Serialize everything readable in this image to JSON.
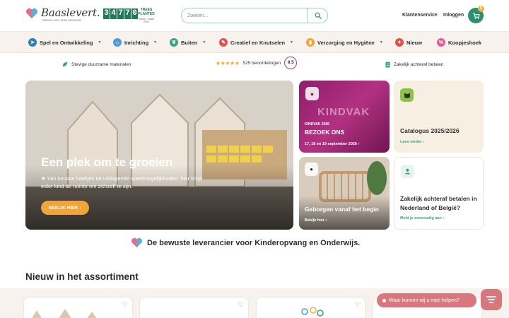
{
  "header": {
    "logo_text": "Baaslevert.",
    "logo_sub": "Samen voor onze toekomst",
    "trees_digits": [
      "3",
      "4",
      "7",
      "7",
      "0"
    ],
    "trees_label": "TREES PLANTED",
    "trees_since": "Sinds 1 maart 2024",
    "search_placeholder": "Zoeken...",
    "customer_service": "Klantenservice",
    "login": "Inloggen",
    "cart_count": "0"
  },
  "nav": {
    "items": [
      {
        "label": "Spel en Ontwikkeling",
        "color": "#2e7fb8",
        "dropdown": true
      },
      {
        "label": "Inrichting",
        "color": "#4a9bd6",
        "dropdown": true
      },
      {
        "label": "Buiten",
        "color": "#3aa184",
        "dropdown": true
      },
      {
        "label": "Creatief en Knutselen",
        "color": "#e0524f",
        "dropdown": true
      },
      {
        "label": "Verzorging en Hygiëne",
        "color": "#f2a33a",
        "dropdown": true
      },
      {
        "label": "Nieuw",
        "color": "#e0524f",
        "dropdown": false
      },
      {
        "label": "Koopjeshoek",
        "color": "#d9609a",
        "dropdown": false
      }
    ]
  },
  "usp": {
    "sustainable": "Stevige duurzame materialen",
    "reviews": "525 beoordelingen",
    "rating": "9.5",
    "pay_later": "Zakelijk achteraf betalen"
  },
  "hero": {
    "title": "Een plek om te groeien",
    "description": "★ Van knusse hoekjes tot uitdagende speelmogelijkheden: hier krijgt ieder kind de ruimte om zichzelf te zijn.",
    "button": "BEKIJK HIER"
  },
  "tiles": {
    "kindvak": {
      "word": "KINDVAK",
      "year": "KINDVAK 2026",
      "title": "BEZOEK ONS",
      "sub": "17, 18 en 19 september 2026"
    },
    "catalog": {
      "title": "Catalogus 2025/2026",
      "link": "Lees verder"
    },
    "baby": {
      "title": "Geborgen vanaf het begin",
      "link": "Bekijk hier"
    },
    "business": {
      "title": "Zakelijk achteraf betalen in Nederland of België?",
      "link": "Meld je eenvoudig aan"
    }
  },
  "tagline": "De bewuste leverancier voor Kinderopvang en Onderwijs.",
  "new_section": {
    "title": "Nieuw in het assortiment"
  },
  "chat": {
    "label": "Waar kunnen wij u mee helpen?"
  },
  "colors": {
    "accent": "#2e8f6f",
    "orange": "#f0a43a",
    "pink": "#d9777f",
    "magenta": "#8d1e6b"
  }
}
